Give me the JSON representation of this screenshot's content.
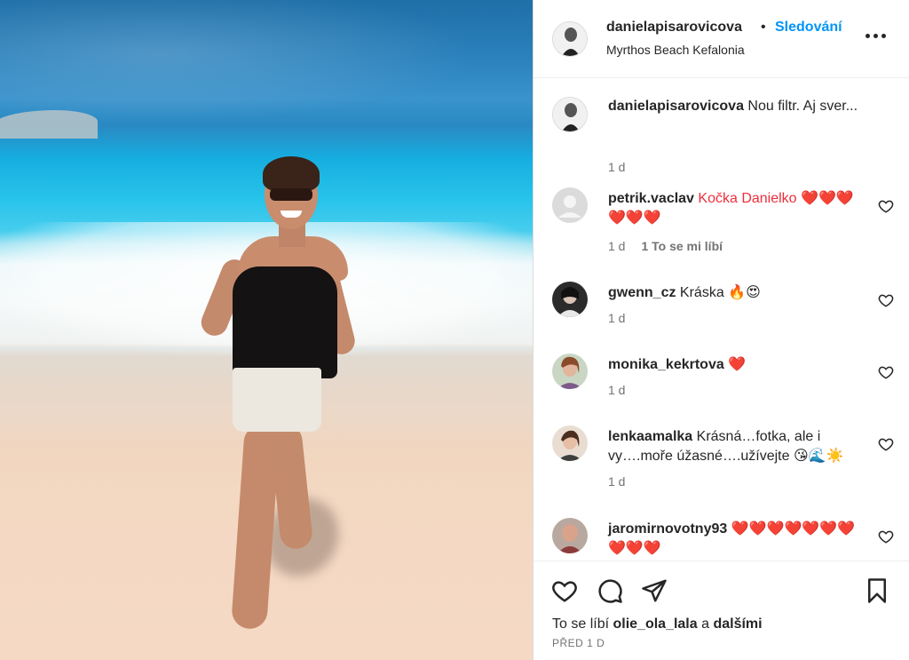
{
  "post": {
    "author": "danielapisarovicova",
    "dot": "•",
    "follow_label": "Sledování",
    "location": "Myrthos Beach Kefalonia",
    "more_icon": "more-options-icon"
  },
  "caption": {
    "user": "danielapisarovicova",
    "text": "Nou filtr. Aj sver...",
    "time": "1 d"
  },
  "comments": [
    {
      "user": "petrik.vaclav",
      "text": "Kočka Danielko ❤️❤️❤️❤️❤️❤️",
      "time": "1 d",
      "likes": "1 To se mi líbí"
    },
    {
      "user": "gwenn_cz",
      "text": "Kráska 🔥😍",
      "time": "1 d"
    },
    {
      "user": "monika_kekrtova",
      "text": "❤️",
      "time": "1 d"
    },
    {
      "user": "lenkaamalka",
      "text": "Krásná…fotka, ale i vy….moře úžasné….užívejte 😘🌊☀️",
      "time": "1 d"
    },
    {
      "user": "jaromirnovotny93",
      "text": "❤️❤️❤️❤️❤️❤️❤️❤️❤️❤️",
      "time": ""
    }
  ],
  "actions": {
    "like_icon": "heart-icon",
    "comment_icon": "comment-icon",
    "share_icon": "share-icon",
    "save_icon": "bookmark-icon"
  },
  "likes": {
    "prefix": "To se líbí",
    "user": "olie_ola_lala",
    "conj": "a",
    "others": "dalšími"
  },
  "timestamp": "PŘED 1 D",
  "colors": {
    "follow_blue": "#0095f6",
    "text": "#262626",
    "muted": "#737373",
    "heart_red": "#ed2f3b"
  }
}
